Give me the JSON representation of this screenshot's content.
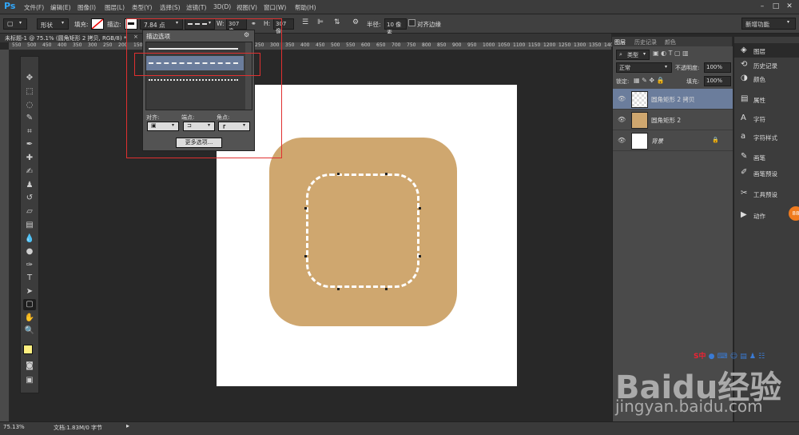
{
  "app": {
    "logo": "Ps"
  },
  "menu": [
    "文件(F)",
    "编辑(E)",
    "图像(I)",
    "图层(L)",
    "类型(Y)",
    "选择(S)",
    "滤镜(T)",
    "3D(D)",
    "视图(V)",
    "窗口(W)",
    "帮助(H)"
  ],
  "options": {
    "mode": "形状",
    "fill_label": "填充:",
    "stroke_label": "描边:",
    "stroke_size": "7.84 点",
    "w_label": "W:",
    "w_value": "307 像",
    "h_label": "H:",
    "h_value": "307 像",
    "radius_label": "半径:",
    "radius_value": "10 像素",
    "align_edges": "对齐边缘",
    "workspace": "新增功能"
  },
  "document": {
    "tab": "未标题-1 @ 75.1% (圆角矩形 2 拷贝, RGB/8) *"
  },
  "ruler_ticks": [
    "550",
    "500",
    "450",
    "400",
    "350",
    "300",
    "250",
    "200",
    "150",
    "100",
    "50",
    "0",
    "50",
    "100",
    "150",
    "200",
    "250",
    "300",
    "350",
    "400",
    "450",
    "500",
    "550",
    "600",
    "650",
    "700",
    "750",
    "800",
    "850",
    "900",
    "950",
    "1000",
    "1050",
    "1100",
    "1150",
    "1200",
    "1250",
    "1300",
    "1350",
    "1400"
  ],
  "stroke_popup": {
    "title": "描边选项",
    "align_label": "对齐:",
    "caps_label": "端点:",
    "corners_label": "角点:",
    "more_button": "更多选项..."
  },
  "layers_panel": {
    "tabs": [
      "图层",
      "历史记录",
      "颜色"
    ],
    "kind": "类型",
    "blend": "正常",
    "opacity_label": "不透明度:",
    "opacity": "100%",
    "lock_label": "锁定:",
    "fill_label": "填充:",
    "fill": "100%",
    "layers": [
      {
        "name": "圆角矩形 2 拷贝",
        "selected": true
      },
      {
        "name": "圆角矩形 2",
        "selected": false
      },
      {
        "name": "背景",
        "selected": false
      }
    ]
  },
  "dock": [
    {
      "icon": "layers-icon",
      "label": "图层"
    },
    {
      "icon": "history-icon",
      "label": "历史记录"
    },
    {
      "icon": "color-icon",
      "label": "颜色"
    },
    {
      "icon": "properties-icon",
      "label": "属性"
    },
    {
      "icon": "character-icon",
      "label": "字符"
    },
    {
      "icon": "character-style-icon",
      "label": "字符样式"
    },
    {
      "icon": "brush-icon",
      "label": "画笔"
    },
    {
      "icon": "brush-preset-icon",
      "label": "画笔预设"
    },
    {
      "icon": "tool-preset-icon",
      "label": "工具预设"
    },
    {
      "icon": "actions-icon",
      "label": "动作"
    }
  ],
  "status": {
    "zoom": "75.13%",
    "doc": "文档:1.83M/0 字节"
  },
  "watermark": {
    "brand": "Baidu经验",
    "url": "jingyan.baidu.com",
    "ime": "S中"
  },
  "colors": {
    "shape_fill": "#cfa76f",
    "foreground": "#fff080",
    "selected_layer": "#6b7d9c"
  }
}
